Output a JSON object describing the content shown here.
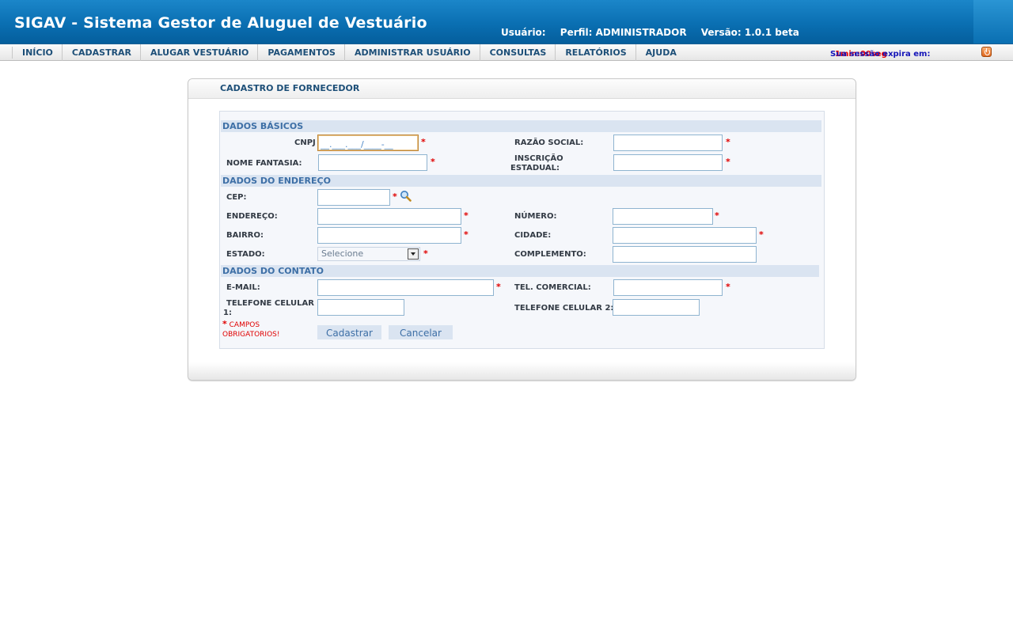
{
  "header": {
    "title": "SIGAV - Sistema Gestor de Aluguel de Vestuário",
    "user_label": "Usuário:",
    "profile": "Perfil: ADMINISTRADOR",
    "version": "Versão: 1.0.1 beta"
  },
  "menu": {
    "items": [
      "INÍCIO",
      "CADASTRAR",
      "ALUGAR VESTUÁRIO",
      "PAGAMENTOS",
      "ADMINISTRAR USUÁRIO",
      "CONSULTAS",
      "RELATÓRIOS",
      "AJUDA"
    ]
  },
  "session": {
    "label": "Sua sessão expira em:",
    "time": "1min:00seg"
  },
  "panel": {
    "title": "CADASTRO DE FORNECEDOR"
  },
  "sections": {
    "basic": "DADOS BÁSICOS",
    "address": "DADOS DO ENDEREÇO",
    "contact": "DADOS DO CONTATO"
  },
  "labels": {
    "cnpj": "CNPJ",
    "razao_social": "RAZÃO SOCIAL:",
    "nome_fantasia": "NOME FANTASIA:",
    "inscricao_estadual_1": "INSCRIÇÃO",
    "inscricao_estadual_2": "ESTADUAL:",
    "cep": "CEP:",
    "endereco": "ENDEREÇO:",
    "numero": "NÚMERO:",
    "bairro": "BAIRRO:",
    "cidade": "CIDADE:",
    "estado": "ESTADO:",
    "complemento": "COMPLEMENTO:",
    "email": "E-MAIL:",
    "tel_comercial": "TEL. COMERCIAL:",
    "telefone_celular_1_a": "TELEFONE CELULAR",
    "telefone_celular_1_b": "1:",
    "telefone_celular_2": "TELEFONE CELULAR 2:"
  },
  "fields": {
    "cnpj_value": "__.___.___/____-__",
    "estado_value": "Selecione"
  },
  "required_mark": "*",
  "required_note_1": "CAMPOS",
  "required_note_2": "OBRIGATORIOS!",
  "buttons": {
    "submit": "Cadastrar",
    "cancel": "Cancelar"
  },
  "colors": {
    "header_blue": "#0a6fb2",
    "menu_text": "#1d4f78",
    "section_bg": "#dae4f1",
    "required_red": "#e00000"
  },
  "icons": {
    "search_cep": "magnifier-icon",
    "logout": "power-icon"
  }
}
